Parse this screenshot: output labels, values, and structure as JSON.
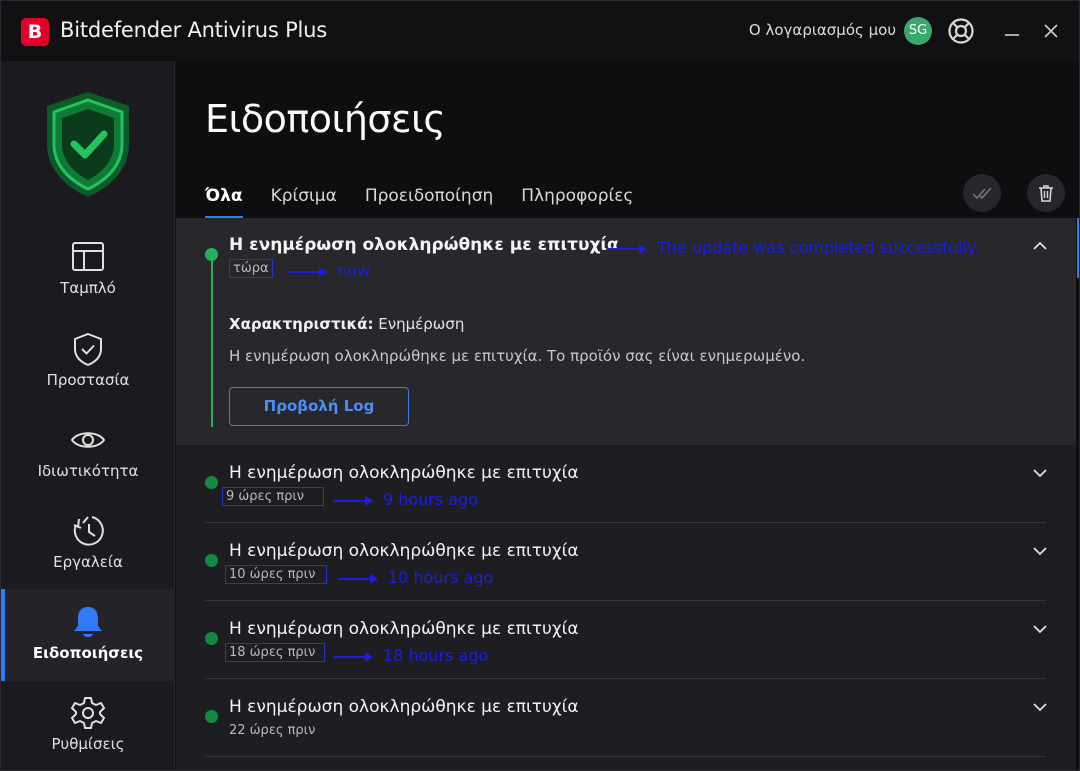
{
  "app": {
    "brand_letter": "B",
    "title": "Bitdefender Antivirus Plus",
    "account_label": "Ο λογαριασμός μου",
    "avatar_initials": "SG",
    "icons": [
      "help-lifebuoy-icon",
      "minimize-icon",
      "close-icon"
    ]
  },
  "sidebar": {
    "items": [
      {
        "label": "Ταμπλό",
        "icon": "dashboard-icon"
      },
      {
        "label": "Προστασία",
        "icon": "protection-shield-icon"
      },
      {
        "label": "Ιδιωτικότητα",
        "icon": "privacy-eye-icon"
      },
      {
        "label": "Εργαλεία",
        "icon": "utilities-clock-icon"
      },
      {
        "label": "Ειδοποιήσεις",
        "icon": "notifications-bell-icon",
        "active": true
      },
      {
        "label": "Ρυθμίσεις",
        "icon": "settings-gear-icon"
      }
    ]
  },
  "main": {
    "title": "Ειδοποιήσεις",
    "tabs": [
      {
        "label": "Όλα",
        "active": true
      },
      {
        "label": "Κρίσιμα"
      },
      {
        "label": "Προειδοποίηση"
      },
      {
        "label": "Πληροφορίες"
      }
    ],
    "tools": [
      "mark-all-read-icon",
      "trash-icon"
    ]
  },
  "notifications": [
    {
      "title": "Η ενημέρωση ολοκληρώθηκε με επιτυχία",
      "time": "τώρα",
      "title_annotation": "The update was completed successfully.",
      "time_annotation": "now",
      "expanded": true,
      "features_label": "Χαρακτηριστικά:",
      "features_value": "Ενημέρωση",
      "description": "Η ενημέρωση ολοκληρώθηκε με επιτυχία. Το προϊόν σας είναι ενημερωμένο.",
      "button_label": "Προβολή Log"
    },
    {
      "title": "Η ενημέρωση ολοκληρώθηκε με επιτυχία",
      "time": "9 ώρες πριν",
      "time_annotation": "9 hours ago"
    },
    {
      "title": "Η ενημέρωση ολοκληρώθηκε με επιτυχία",
      "time": "10 ώρες πριν",
      "time_annotation": "10 hours ago"
    },
    {
      "title": "Η ενημέρωση ολοκληρώθηκε με επιτυχία",
      "time": "18 ώρες πριν",
      "time_annotation": "18 hours ago"
    },
    {
      "title": "Η ενημέρωση ολοκληρώθηκε με επιτυχία",
      "time": "22 ώρες πριν"
    }
  ],
  "colors": {
    "brand_red": "#e4002b",
    "accent_blue": "#2f7bf5",
    "success_green": "#21b35b",
    "annotation_blue": "#1a1fe0"
  }
}
